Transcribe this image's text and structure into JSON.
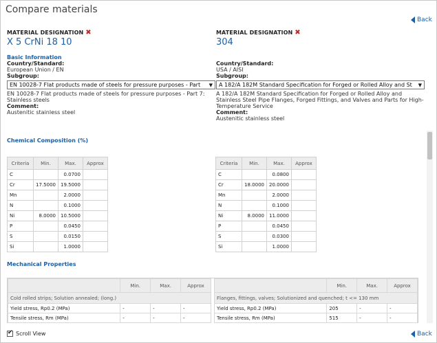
{
  "window": {
    "title": "Compare materials"
  },
  "back_label": "Back",
  "materials": [
    {
      "designation_label": "MATERIAL DESIGNATION",
      "name": "X 5 CrNi 18 10",
      "basic_info_title": "Basic Information",
      "country_label": "Country/Standard:",
      "country_value": "European Union / EN",
      "subgroup_label": "Subgroup:",
      "subgroup_select": "EN 10028-7 Flat products made of steels for pressure purposes - Part",
      "subgroup_desc": "EN 10028-7 Flat products made of steels for pressure purposes - Part 7: Stainless steels",
      "comment_label": "Comment:",
      "comment_value": "Austenitic stainless steel"
    },
    {
      "designation_label": "MATERIAL DESIGNATION",
      "name": "304",
      "basic_info_title": "",
      "country_label": "Country/Standard:",
      "country_value": "USA / AISI",
      "subgroup_label": "Subgroup:",
      "subgroup_select": "A 182/A 182M Standard Specification for Forged or Rolled Alloy and St",
      "subgroup_desc": "A 182/A 182M Standard Specification for Forged or Rolled Alloy and Stainless Steel Pipe Flanges, Forged Fittings, and Valves and Parts for High-Temperature Service",
      "comment_label": "Comment:",
      "comment_value": "Austenitic stainless steel"
    }
  ],
  "chemical": {
    "title": "Chemical Composition (%)",
    "headers": [
      "Criteria",
      "Min.",
      "Max.",
      "Approx"
    ],
    "a": [
      [
        "C",
        "",
        "0.0700",
        ""
      ],
      [
        "Cr",
        "17.5000",
        "19.5000",
        ""
      ],
      [
        "Mn",
        "",
        "2.0000",
        ""
      ],
      [
        "N",
        "",
        "0.1000",
        ""
      ],
      [
        "Ni",
        "8.0000",
        "10.5000",
        ""
      ],
      [
        "P",
        "",
        "0.0450",
        ""
      ],
      [
        "S",
        "",
        "0.0150",
        ""
      ],
      [
        "Si",
        "",
        "1.0000",
        ""
      ]
    ],
    "b": [
      [
        "C",
        "",
        "0.0800",
        ""
      ],
      [
        "Cr",
        "18.0000",
        "20.0000",
        ""
      ],
      [
        "Mn",
        "",
        "2.0000",
        ""
      ],
      [
        "N",
        "",
        "0.1000",
        ""
      ],
      [
        "Ni",
        "8.0000",
        "11.0000",
        ""
      ],
      [
        "P",
        "",
        "0.0450",
        ""
      ],
      [
        "S",
        "",
        "0.0300",
        ""
      ],
      [
        "Si",
        "",
        "1.0000",
        ""
      ]
    ]
  },
  "mechanical": {
    "title": "Mechanical Properties",
    "headers": [
      "Min.",
      "Max.",
      "Approx"
    ],
    "a": {
      "condition": "Cold rolled strips; Solution annealed; (long.)",
      "rows": [
        [
          "Yield stress, Rp0.2 (MPa)",
          "-",
          "-",
          "-"
        ],
        [
          "Tensile stress, Rm (MPa)",
          "-",
          "-",
          "-"
        ]
      ]
    },
    "b": {
      "condition": "Flanges, fittings, valves; Solutionized and quenched; t <= 130 mm",
      "rows": [
        [
          "Yield stress, Rp0.2 (MPa)",
          "205",
          "-",
          "-"
        ],
        [
          "Tensile stress, Rm (MPa)",
          "515",
          "-",
          "-"
        ]
      ]
    }
  },
  "footer": {
    "scroll_view_label": "Scroll View",
    "scroll_view_checked": true
  }
}
